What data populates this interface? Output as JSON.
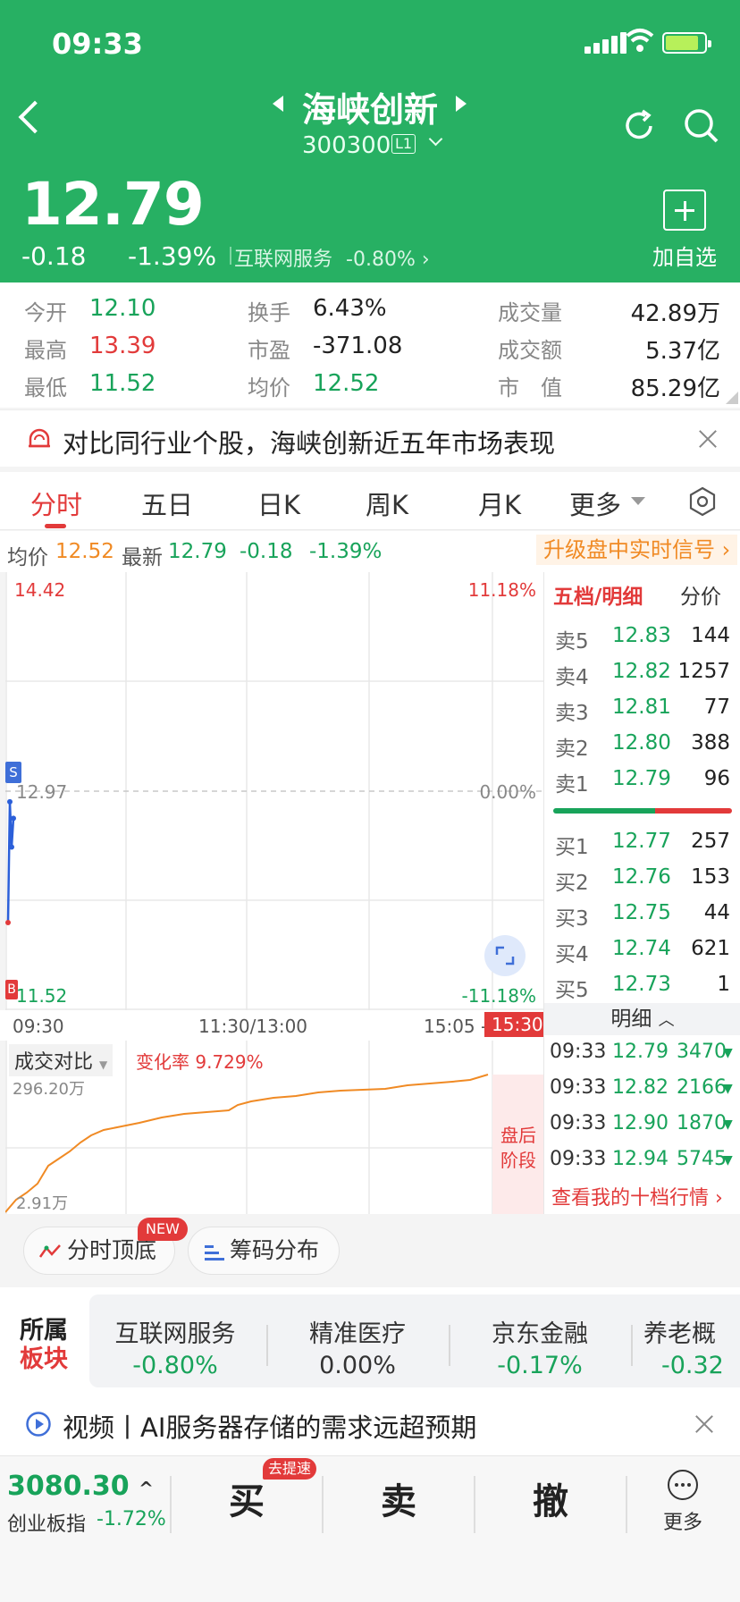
{
  "status_bar": {
    "time": "09:33"
  },
  "header": {
    "stock_name": "海峡创新",
    "code": "300300",
    "level": "L1",
    "price": "12.79",
    "change": "-0.18",
    "change_pct": "-1.39%",
    "industry": "互联网服务",
    "industry_pct": "-0.80%",
    "add_label": "加自选",
    "colors": {
      "header_bg": "#27b063",
      "up": "#e23a3a",
      "down": "#18a35a"
    }
  },
  "stats": [
    {
      "label": "今开",
      "value": "12.10",
      "color": "down"
    },
    {
      "label": "最高",
      "value": "13.39",
      "color": "up"
    },
    {
      "label": "最低",
      "value": "11.52",
      "color": "down"
    },
    {
      "label": "换手",
      "value": "6.43%",
      "color": "plain"
    },
    {
      "label": "市盈",
      "value": "-371.08",
      "color": "plain"
    },
    {
      "label": "均价",
      "value": "12.52",
      "color": "down"
    },
    {
      "label": "成交量",
      "value": "42.89万"
    },
    {
      "label": "成交额",
      "value": "5.37亿"
    },
    {
      "label": "市　值",
      "value": "85.29亿"
    }
  ],
  "banner": {
    "text": "对比同行业个股，海峡创新近五年市场表现"
  },
  "tabs": [
    "分时",
    "五日",
    "日K",
    "周K",
    "月K",
    "更多"
  ],
  "info_line": {
    "avg_label": "均价",
    "avg_value": "12.52",
    "latest_label": "最新",
    "latest_value": "12.79",
    "change": "-0.18",
    "change_pct": "-1.39%",
    "upgrade": "升级盘中实时信号"
  },
  "chart_data": {
    "type": "line",
    "y_top_label": "14.42",
    "y_mid_label": "12.97",
    "y_bottom_label": "11.52",
    "pct_top_label": "11.18%",
    "pct_mid_label": "0.00%",
    "pct_bottom_label": "-11.18%",
    "ylim": [
      11.52,
      14.42
    ],
    "series": [
      {
        "x": [
          "09:30",
          "09:31",
          "09:32",
          "09:33"
        ],
        "values": [
          12.1,
          12.9,
          12.6,
          12.79
        ]
      }
    ],
    "x_labels": [
      "09:30",
      "11:30/13:00",
      "15:05 -",
      "15:30"
    ],
    "markers": {
      "sell": "S",
      "buy": "B"
    }
  },
  "volume_chart": {
    "label": "成交对比",
    "change_rate": "变化率 9.729%",
    "top_label": "296.20万",
    "bottom_label": "2.91万",
    "after_hours": [
      "盘后",
      "阶段"
    ]
  },
  "order_book": {
    "tab_active": "五档/明细",
    "tab_other": "分价",
    "asks": [
      {
        "label": "卖5",
        "price": "12.83",
        "vol": "144"
      },
      {
        "label": "卖4",
        "price": "12.82",
        "vol": "1257"
      },
      {
        "label": "卖3",
        "price": "12.81",
        "vol": "77"
      },
      {
        "label": "卖2",
        "price": "12.80",
        "vol": "388"
      },
      {
        "label": "卖1",
        "price": "12.79",
        "vol": "96"
      }
    ],
    "bids": [
      {
        "label": "买1",
        "price": "12.77",
        "vol": "257"
      },
      {
        "label": "买2",
        "price": "12.76",
        "vol": "153"
      },
      {
        "label": "买3",
        "price": "12.75",
        "vol": "44"
      },
      {
        "label": "买4",
        "price": "12.74",
        "vol": "621"
      },
      {
        "label": "买5",
        "price": "12.73",
        "vol": "1"
      }
    ],
    "detail_label": "明细",
    "ticks": [
      {
        "time": "09:33",
        "price": "12.79",
        "vol": "3470"
      },
      {
        "time": "09:33",
        "price": "12.82",
        "vol": "2166"
      },
      {
        "time": "09:33",
        "price": "12.90",
        "vol": "1870"
      },
      {
        "time": "09:33",
        "price": "12.94",
        "vol": "5745"
      }
    ],
    "view_more": "查看我的十档行情"
  },
  "features": {
    "btn1": "分时顶底",
    "badge": "NEW",
    "btn2": "筹码分布"
  },
  "sectors": {
    "title1": "所属",
    "title2": "板块",
    "items": [
      {
        "name": "互联网服务",
        "value": "-0.80%"
      },
      {
        "name": "精准医疗",
        "value": "0.00%"
      },
      {
        "name": "京东金融",
        "value": "-0.17%"
      },
      {
        "name": "养老概",
        "value": "-0.32"
      }
    ]
  },
  "video": {
    "text": "视频丨AI服务器存储的需求远超预期"
  },
  "bottom": {
    "index_value": "3080.30",
    "index_name": "创业板指",
    "index_pct": "-1.72%",
    "buy": "买",
    "buy_badge": "去提速",
    "sell": "卖",
    "cancel": "撤",
    "more": "更多"
  }
}
